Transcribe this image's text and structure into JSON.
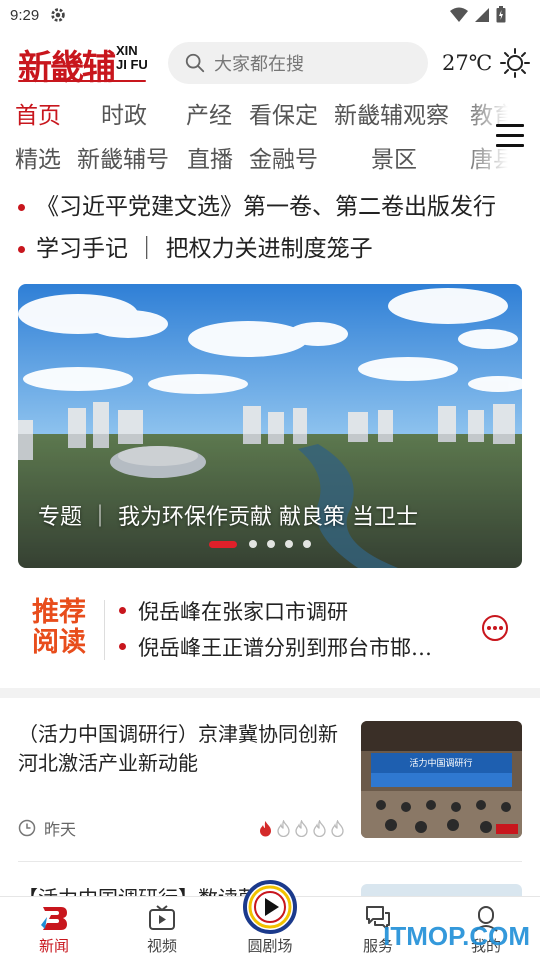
{
  "status_bar": {
    "time": "9:29"
  },
  "header": {
    "logo_cn": "新畿辅",
    "logo_en_line1": "XIN",
    "logo_en_line2": "JI FU",
    "search_placeholder": "大家都在搜",
    "temperature": "27℃"
  },
  "nav": {
    "row1": [
      "首页",
      "时政",
      "产经",
      "看保定",
      "新畿辅观察",
      "教育"
    ],
    "row2": [
      "精选",
      "新畿辅号",
      "直播",
      "金融号",
      "景区",
      "唐县"
    ],
    "active": "首页"
  },
  "headlines": [
    "《习近平党建文选》第一卷、第二卷出版发行",
    "学习手记 ｜ 把权力关进制度笼子"
  ],
  "banner": {
    "caption": "专题 ｜ 我为环保作贡献 献良策 当卫士",
    "slide_count": 5,
    "active_slide": 1
  },
  "recommend": {
    "label_line1": "推荐",
    "label_line2": "阅读",
    "items": [
      "倪岳峰在张家口市调研",
      "倪岳峰王正谱分别到邢台市邯…"
    ]
  },
  "articles": [
    {
      "title": "（活力中国调研行）京津冀协同创新 河北激活产业新动能",
      "time": "昨天",
      "heat_level": 1,
      "heat_max": 5,
      "thumb_banner_text": "活力中国调研行"
    },
    {
      "title": "【活力中国调研行】数读蔚县"
    }
  ],
  "bottom_nav": [
    {
      "label": "新闻",
      "icon": "news-logo-icon",
      "active": true
    },
    {
      "label": "视频",
      "icon": "video-icon",
      "active": false
    },
    {
      "label": "圆剧场",
      "icon": "play-circle-icon",
      "active": false
    },
    {
      "label": "服务",
      "icon": "chat-bubbles-icon",
      "active": false
    },
    {
      "label": "我的",
      "icon": "user-icon",
      "active": false
    }
  ],
  "watermark": "ITMOP.COM",
  "colors": {
    "brand_red": "#c8161d",
    "recommend_orange": "#e84d1c",
    "link_blue": "#1f8fd8"
  }
}
